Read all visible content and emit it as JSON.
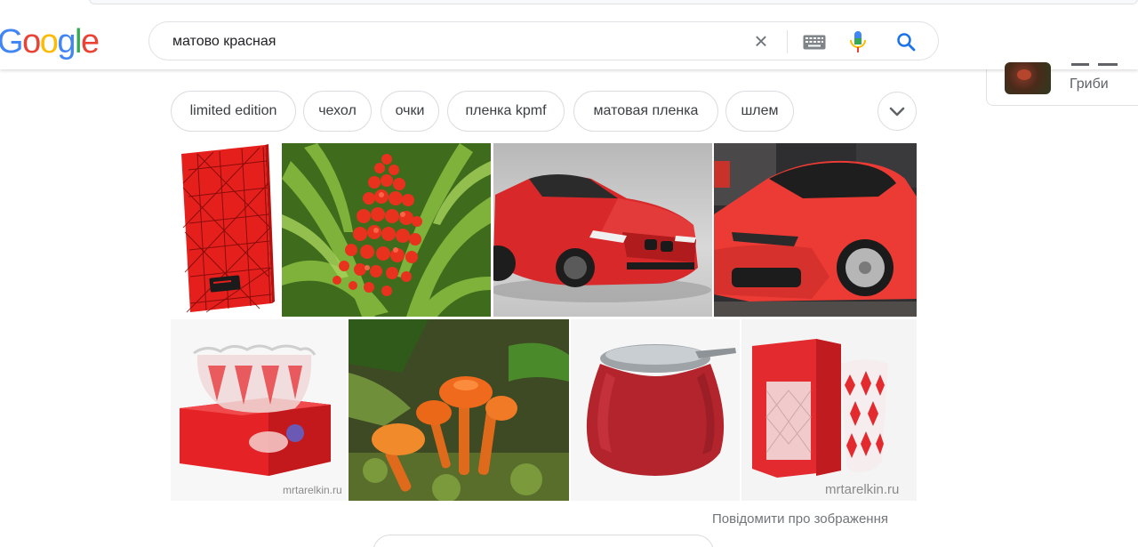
{
  "logo": {
    "text": "Google",
    "letters": [
      "G",
      "o",
      "o",
      "g",
      "l",
      "e"
    ],
    "colors": [
      "#4285f4",
      "#ea4335",
      "#fbbc05",
      "#4285f4",
      "#34a853",
      "#ea4335"
    ]
  },
  "search": {
    "query": "матово красная"
  },
  "knowledge_panel": {
    "label": "Гриби"
  },
  "chips": [
    {
      "label": "limited edition"
    },
    {
      "label": "чехол"
    },
    {
      "label": "очки"
    },
    {
      "label": "пленка kpmf"
    },
    {
      "label": "матовая пленка"
    },
    {
      "label": "шлем"
    }
  ],
  "images": [
    {
      "icon": "red-notebook"
    },
    {
      "icon": "red-flower-plant"
    },
    {
      "icon": "red-bmw-car"
    },
    {
      "icon": "red-audi-car"
    },
    {
      "icon": "crystal-bowl-box",
      "watermark": "mrtarelkin.ru"
    },
    {
      "icon": "orange-mushrooms"
    },
    {
      "icon": "red-sugar-bowl"
    },
    {
      "icon": "crystal-vase-box",
      "watermark": "mrtarelkin.ru"
    }
  ],
  "report_link": "Повідомити про зображення",
  "colors": {
    "accent_blue": "#1a73e8",
    "mic_red": "#ea4335",
    "chip_border": "#dadce0"
  }
}
